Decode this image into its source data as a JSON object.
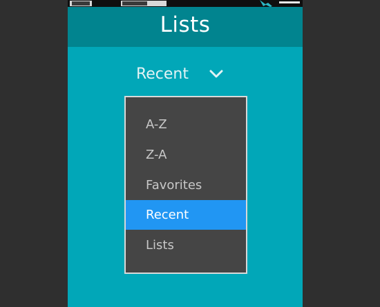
{
  "header": {
    "title": "Lists"
  },
  "sort": {
    "selected": "Recent",
    "options": [
      {
        "label": "A-Z",
        "selected": false
      },
      {
        "label": "Z-A",
        "selected": false
      },
      {
        "label": "Favorites",
        "selected": false
      },
      {
        "label": "Recent",
        "selected": true
      },
      {
        "label": "Lists",
        "selected": false
      }
    ]
  },
  "colors": {
    "background": "#2f2f2f",
    "app_background": "#01a7b8",
    "header_background": "#01848f",
    "dropdown_background": "#454545",
    "selected_option": "#2196f3"
  },
  "icons": {
    "chevron": "chevron-down-icon",
    "status": "wrench-icon"
  }
}
